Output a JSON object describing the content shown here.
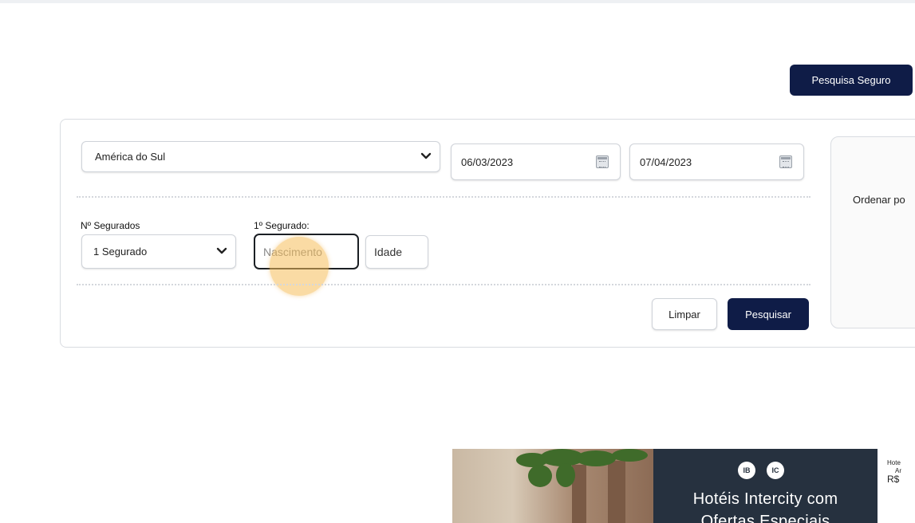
{
  "header": {
    "pesquisa_seguro_label": "Pesquisa Seguro"
  },
  "search": {
    "region_value": "América do Sul",
    "date_start": "06/03/2023",
    "date_end": "07/04/2023",
    "n_segurados_label": "Nº Segurados",
    "segurados_value": "1 Segurado",
    "primeiro_segurado_label": "1º Segurado:",
    "nascimento_placeholder": "Nascimento",
    "idade_placeholder": "Idade",
    "limpar_label": "Limpar",
    "pesquisar_label": "Pesquisar"
  },
  "sort_panel": {
    "label": "Ordenar po"
  },
  "banner": {
    "title": "Hotéis Intercity com",
    "subtitle": "Ofertas Especiais",
    "logo_1": "IB",
    "logo_2": "IC"
  },
  "side_ad": {
    "line1": "Hote",
    "line2": "Ar",
    "price": "R$"
  },
  "colors": {
    "primary_button": "#0f1c47",
    "banner_dark": "#26313f",
    "click_highlight": "#f5be5a"
  }
}
